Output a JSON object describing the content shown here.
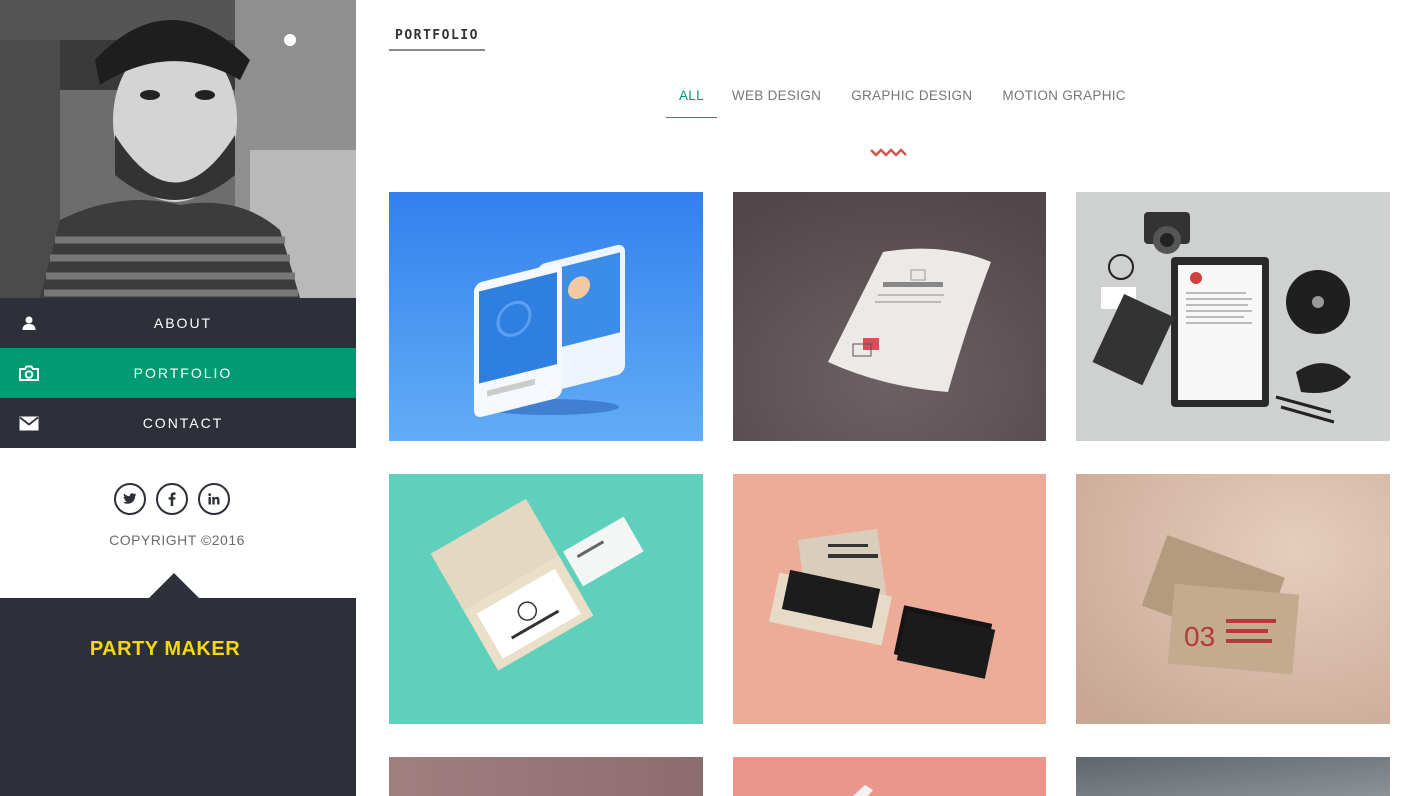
{
  "nav": {
    "items": [
      {
        "label": "ABOUT",
        "icon": "user-icon"
      },
      {
        "label": "PORTFOLIO",
        "icon": "camera-icon"
      },
      {
        "label": "CONTACT",
        "icon": "envelope-icon"
      }
    ],
    "active_index": 1
  },
  "social": [
    "twitter-icon",
    "facebook-icon",
    "linkedin-icon"
  ],
  "copyright": "COPYRIGHT ©2016",
  "brand": "PARTY MAKER",
  "page_title": "PORTFOLIO",
  "filters": [
    {
      "label": "ALL",
      "active": true
    },
    {
      "label": "WEB DESIGN",
      "active": false
    },
    {
      "label": "GRAPHIC DESIGN",
      "active": false
    },
    {
      "label": "MOTION GRAPHIC",
      "active": false
    }
  ],
  "colors": {
    "accent": "#009b72",
    "sidebar_dark": "#2d3038",
    "brand_yellow": "#f5d90a",
    "zigzag": "#d9534f"
  },
  "portfolio": [
    {
      "name": "app-screens-mockup",
      "bg": "#3d8ef0"
    },
    {
      "name": "gravity-paper-mockup",
      "bg": "#5a4e52"
    },
    {
      "name": "stationery-camera-mockup",
      "bg": "#cfd0d0"
    },
    {
      "name": "business-card-box-teal",
      "bg": "#5fd0bc"
    },
    {
      "name": "darko-card-box-mockup",
      "bg": "#ecac98"
    },
    {
      "name": "recycled-paper-business-card",
      "bg": "#dcc0ae"
    },
    {
      "name": "tile-row3-1",
      "bg": "#9e7a7d"
    },
    {
      "name": "tile-row3-2",
      "bg": "#ec958c"
    },
    {
      "name": "tile-row3-3",
      "bg": "#6c7378"
    }
  ]
}
